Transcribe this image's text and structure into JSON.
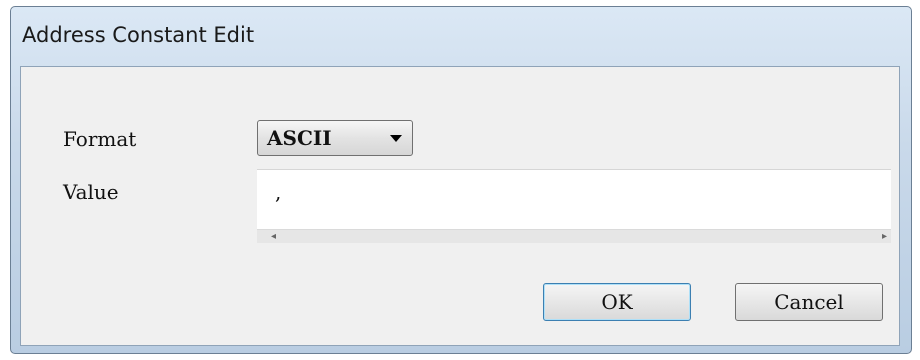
{
  "dialog": {
    "title": "Address Constant Edit"
  },
  "form": {
    "format_label": "Format",
    "format_selected": "ASCII",
    "value_label": "Value",
    "value_text": ","
  },
  "buttons": {
    "ok_label": "OK",
    "cancel_label": "Cancel"
  },
  "icons": {
    "dropdown": "chevron-down-icon",
    "scroll_left": "scroll-left-icon",
    "scroll_right": "scroll-right-icon"
  }
}
